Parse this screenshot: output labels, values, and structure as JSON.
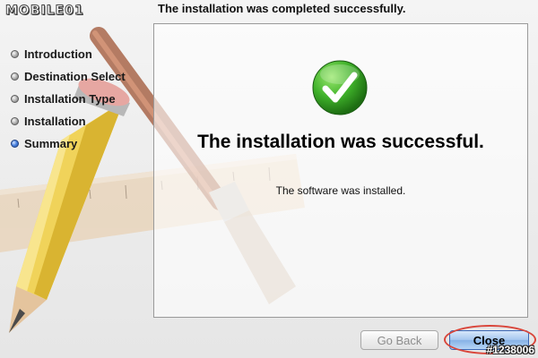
{
  "watermark": {
    "brand": "MOBILE01"
  },
  "header": {
    "title": "The installation was completed successfully."
  },
  "sidebar": {
    "steps": [
      {
        "label": "Introduction",
        "active": false
      },
      {
        "label": "Destination Select",
        "active": false
      },
      {
        "label": "Installation Type",
        "active": false
      },
      {
        "label": "Installation",
        "active": false
      },
      {
        "label": "Summary",
        "active": true
      }
    ]
  },
  "content": {
    "icon": "checkmark-icon",
    "heading": "The installation was successful.",
    "detail": "The software was installed."
  },
  "buttons": {
    "back_label": "Go Back",
    "close_label": "Close"
  },
  "footer": {
    "photo_id": "#1238006"
  },
  "colors": {
    "success_green": "#3fb12a",
    "active_step_blue": "#2f66c4",
    "default_button_blue": "#9dc2ee",
    "highlight_red": "#d9463b"
  }
}
